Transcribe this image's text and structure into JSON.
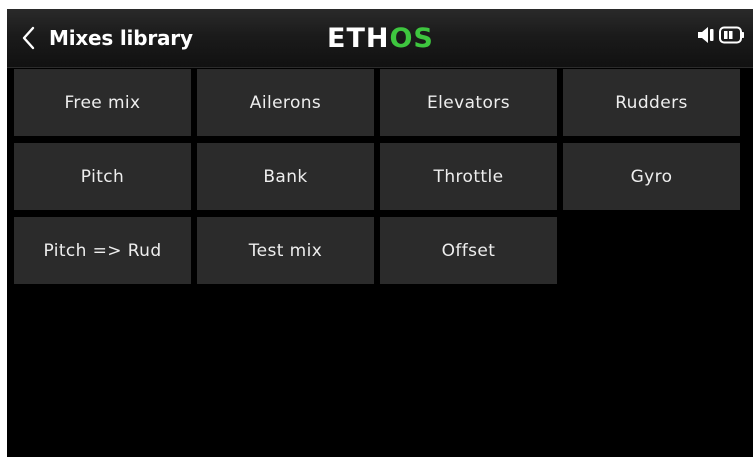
{
  "header": {
    "title": "Mixes library",
    "back_icon": "chevron-left-icon",
    "logo": {
      "part1": "ETH",
      "part2": "OS"
    },
    "status_icons": [
      "speaker-icon",
      "battery-icon"
    ]
  },
  "colors": {
    "background": "#000000",
    "tile": "#2b2b2b",
    "text": "#eeeeee",
    "logo_accent": "#3ec63f"
  },
  "mixes": [
    {
      "label": "Free mix"
    },
    {
      "label": "Ailerons"
    },
    {
      "label": "Elevators"
    },
    {
      "label": "Rudders"
    },
    {
      "label": "Pitch"
    },
    {
      "label": "Bank"
    },
    {
      "label": "Throttle"
    },
    {
      "label": "Gyro"
    },
    {
      "label": "Pitch => Rud"
    },
    {
      "label": "Test mix"
    },
    {
      "label": "Offset"
    }
  ]
}
